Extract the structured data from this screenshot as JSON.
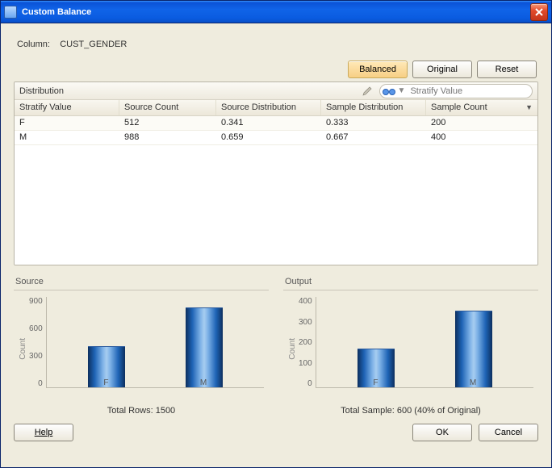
{
  "window": {
    "title": "Custom Balance"
  },
  "column_label": "Column:",
  "column_value": "CUST_GENDER",
  "buttons": {
    "balanced": "Balanced",
    "original": "Original",
    "reset": "Reset",
    "ok": "OK",
    "cancel": "Cancel",
    "help": "Help"
  },
  "table": {
    "distribution_label": "Distribution",
    "search_placeholder": "Stratify Value",
    "columns": [
      "Stratify Value",
      "Source Count",
      "Source Distribution",
      "Sample Distribution",
      "Sample Count"
    ],
    "rows": [
      {
        "stratify": "F",
        "source_count": "512",
        "source_dist": "0.341",
        "sample_dist": "0.333",
        "sample_count": "200"
      },
      {
        "stratify": "M",
        "source_count": "988",
        "source_dist": "0.659",
        "sample_dist": "0.667",
        "sample_count": "400"
      }
    ]
  },
  "charts": {
    "source": {
      "title": "Source",
      "footer": "Total Rows: 1500",
      "ylabel": "Count",
      "yticks": [
        "900",
        "600",
        "300",
        "0"
      ]
    },
    "output": {
      "title": "Output",
      "footer": "Total Sample: 600 (40% of Original)",
      "ylabel": "Count",
      "yticks": [
        "400",
        "300",
        "200",
        "100",
        "0"
      ]
    }
  },
  "chart_data": [
    {
      "type": "bar",
      "title": "Source",
      "ylabel": "Count",
      "categories": [
        "F",
        "M"
      ],
      "values": [
        512,
        988
      ],
      "ylim": [
        0,
        1000
      ]
    },
    {
      "type": "bar",
      "title": "Output",
      "ylabel": "Count",
      "categories": [
        "F",
        "M"
      ],
      "values": [
        200,
        400
      ],
      "ylim": [
        0,
        420
      ]
    }
  ]
}
